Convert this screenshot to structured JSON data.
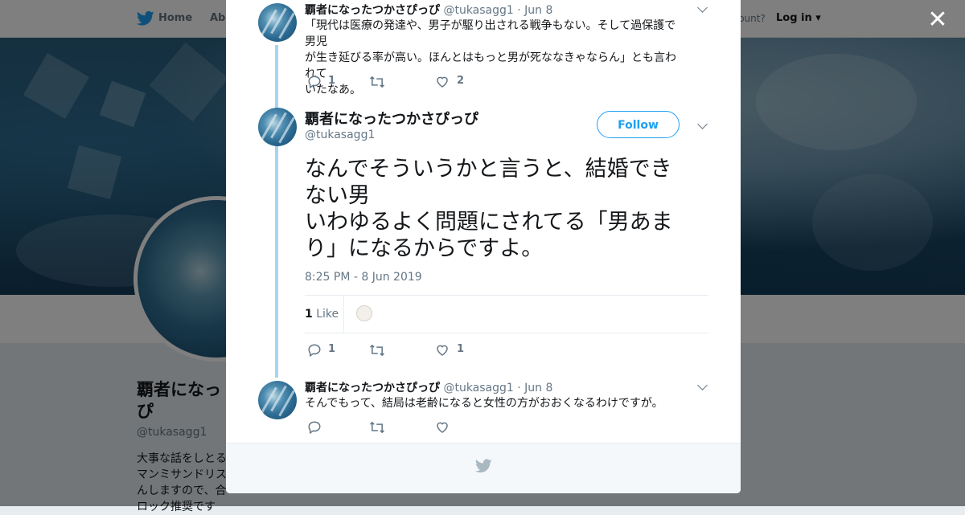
{
  "nav": {
    "home_label": "Home",
    "about_label": "Abo",
    "account_text": "ccount?",
    "login_label": "Log in"
  },
  "profile": {
    "name": "覇者になったつかさぴっぴ",
    "name_visible": "覇者になっ",
    "name_line2": "ぴ",
    "handle": "@tukasagg1",
    "bio_lines": [
      "大事な話をしとる",
      "マンミサンドリス",
      "んしますので、合",
      "ロック推奨です"
    ]
  },
  "tweets": [
    {
      "name": "覇者になったつかさぴっぴ",
      "handle": "@tukasagg1",
      "date": "Jun 8",
      "text_lines": [
        "「現代は医療の発達や、男子が駆り出される戦争もない。そして過保護で男児",
        "が生き延びる率が高い。ほんとはもっと男が死ななきゃならん」とも言われて",
        "いたなあ。"
      ],
      "replies": "1",
      "retweets": "",
      "likes": "2"
    },
    {
      "name": "覇者になったつかさぴっぴ",
      "handle": "@tukasagg1",
      "date": "Jun 8",
      "text_lines": [
        "そんでもって、結局は老齢になると女性の方がおおくなるわけですが。"
      ],
      "replies": "",
      "retweets": "",
      "likes": ""
    }
  ],
  "main_tweet": {
    "name": "覇者になったつかさぴっぴ",
    "handle": "@tukasagg1",
    "follow_label": "Follow",
    "text_lines": [
      "なんでそういうかと言うと、結婚でき",
      "ない男",
      "いわゆるよく問題にされてる「男あま",
      "り」になるからですよ。"
    ],
    "timestamp": "8:25 PM - 8 Jun 2019",
    "like_count": "1",
    "like_label": "Like",
    "replies": "1",
    "retweets": "",
    "likes": "1"
  },
  "icons": {
    "close": "close-icon",
    "reply": "reply-icon",
    "retweet": "retweet-icon",
    "like": "heart-icon",
    "more": "chevron-down-icon",
    "brand": "twitter-bird-icon"
  },
  "colors": {
    "accent": "#1da1f2",
    "thread_line": "#a6d4f2",
    "muted": "#657786",
    "text": "#14171a"
  }
}
